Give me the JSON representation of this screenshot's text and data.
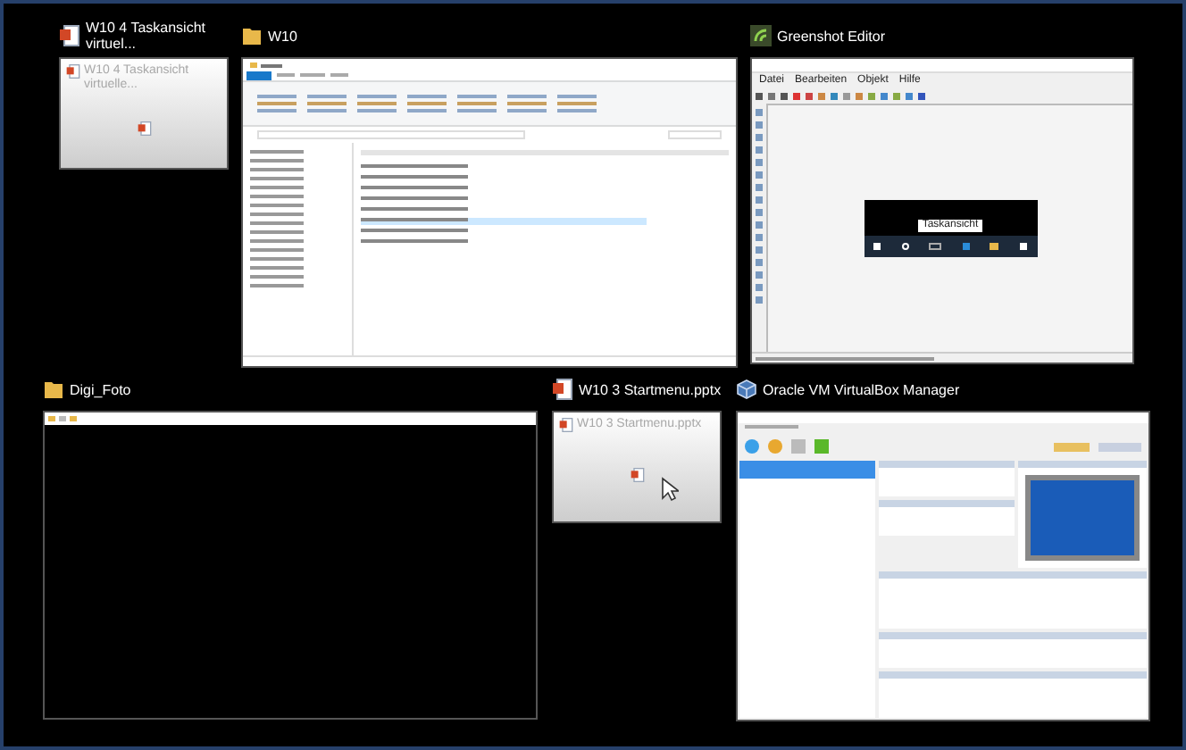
{
  "task_view": {
    "rows": [
      [
        {
          "title": "W10 4 Taskansicht virtuel...",
          "kind": "pptx",
          "preview": {
            "kind": "slide",
            "heading": "W10 4 Taskansicht virtuelle...",
            "cursor": false
          }
        },
        {
          "title": "W10",
          "kind": "folder",
          "preview": {
            "kind": "explorer"
          }
        },
        {
          "title": "Greenshot Editor",
          "kind": "greenshot",
          "preview": {
            "kind": "editor",
            "menu": [
              "Datei",
              "Bearbeiten",
              "Objekt",
              "Hilfe"
            ],
            "tooltip": "Taskansicht"
          }
        }
      ],
      [
        {
          "title": "Digi_Foto",
          "kind": "folder",
          "preview": {
            "kind": "blank_explorer"
          }
        },
        {
          "title": "W10 3 Startmenu.pptx",
          "kind": "pptx",
          "preview": {
            "kind": "slide",
            "heading": "W10 3 Startmenu.pptx",
            "cursor": true
          }
        },
        {
          "title": "Oracle VM VirtualBox Manager",
          "kind": "virtualbox",
          "preview": {
            "kind": "virtualbox"
          }
        }
      ]
    ]
  }
}
